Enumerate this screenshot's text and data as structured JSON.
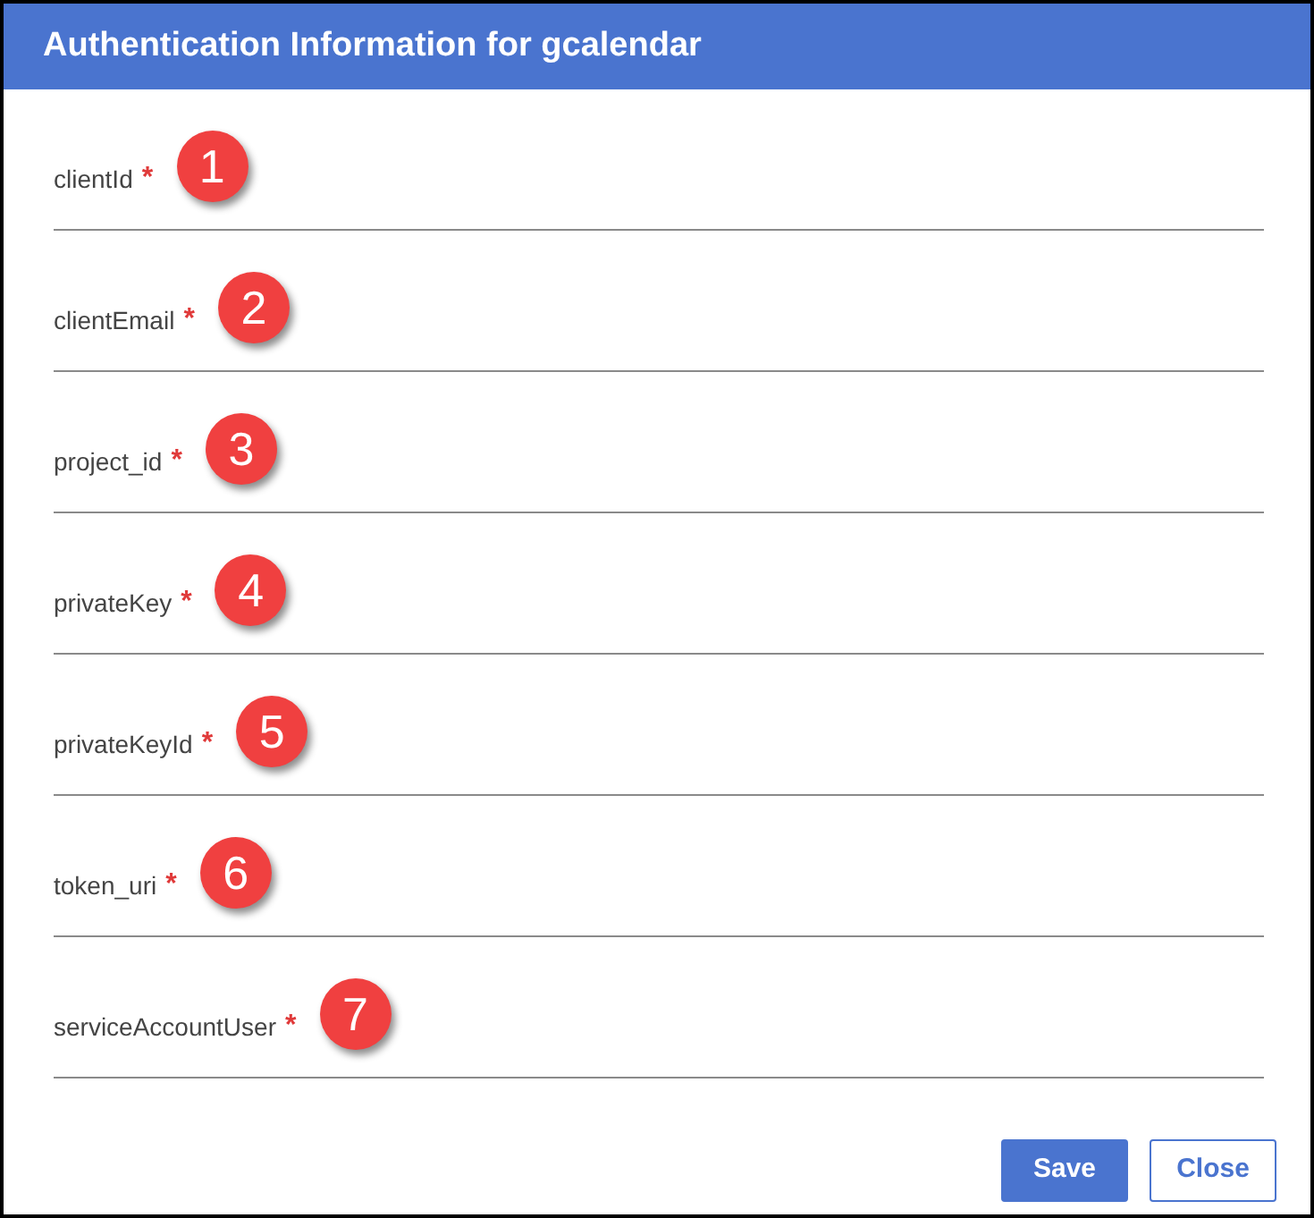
{
  "dialog": {
    "title": "Authentication Information for gcalendar"
  },
  "fields": [
    {
      "label": "clientId",
      "required": true,
      "callout": "1"
    },
    {
      "label": "clientEmail",
      "required": true,
      "callout": "2"
    },
    {
      "label": "project_id",
      "required": true,
      "callout": "3"
    },
    {
      "label": "privateKey",
      "required": true,
      "callout": "4"
    },
    {
      "label": "privateKeyId",
      "required": true,
      "callout": "5"
    },
    {
      "label": "token_uri",
      "required": true,
      "callout": "6"
    },
    {
      "label": "serviceAccountUser",
      "required": true,
      "callout": "7"
    }
  ],
  "buttons": [
    {
      "label": "Save",
      "kind": "primary"
    },
    {
      "label": "Close",
      "kind": "secondary"
    }
  ],
  "required_mark": "*"
}
